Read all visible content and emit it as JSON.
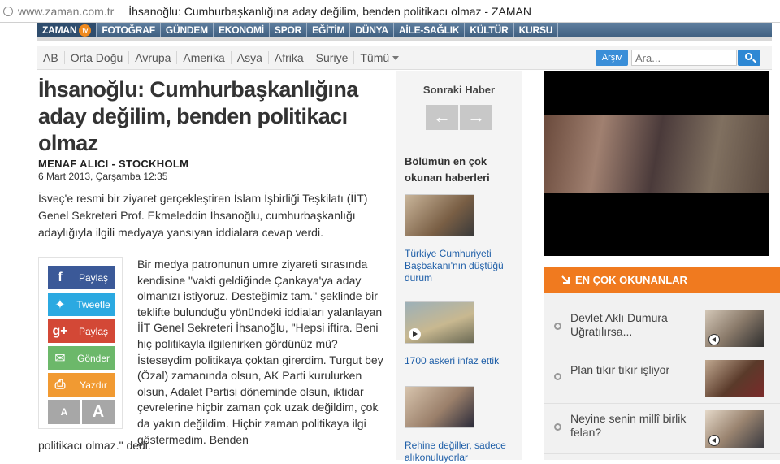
{
  "browser": {
    "url": "www.zaman.com.tr",
    "title": "İhsanoğlu: Cumhurbaşkanlığına aday değilim, benden politikacı olmaz - ZAMAN"
  },
  "main_nav": {
    "logo": "ZAMAN",
    "logo_badge": "tv",
    "items": [
      "FOTOĞRAF",
      "GÜNDEM",
      "EKONOMİ",
      "SPOR",
      "EĞİTİM",
      "DÜNYA",
      "AİLE-SAĞLIK",
      "KÜLTÜR",
      "KURSU"
    ]
  },
  "sub_nav": {
    "items": [
      "AB",
      "Orta Doğu",
      "Avrupa",
      "Amerika",
      "Asya",
      "Afrika",
      "Suriye",
      "Tümü"
    ],
    "archive_button": "Arşiv",
    "search_placeholder": "Ara..."
  },
  "article": {
    "headline": "İhsanoğlu: Cumhurbaşkanlığına aday değilim, benden politikacı olmaz",
    "author": "MENAF ALICI - STOCKHOLM",
    "date": "6 Mart 2013, Çarşamba  12:35",
    "lead": "İsveç'e resmi bir ziyaret gerçekleştiren İslam İşbirliği Teşkilatı (İİT) Genel Sekreteri Prof. Ekmeleddin İhsanoğlu, cumhurbaşkanlığı adaylığıyla ilgili medyaya yansıyan iddialara cevap verdi.",
    "body_part1": "Bir medya patronunun umre ziyareti sırasında kendisine \"vakti geldiğinde Çankaya'ya aday olmanızı istiyoruz. Desteğimiz tam.\" şeklinde bir teklifte bulunduğu yönündeki iddiaları yalanlayan İİT Genel Sekreteri İhsanoğlu, \"Hepsi iftira. Beni hiç politikayla ilgilenirken gördünüz mü? İsteseydim politikaya çoktan girerdim. Turgut bey (Özal) zamanında olsun, AK Parti kurulurken olsun, Adalet Partisi döneminde olsun, iktidar çevrelerine hiçbir zaman çok uzak değildim, çok da yakın değildim. Hiçbir zaman politikaya ilgi göstermedim. Benden",
    "body_part2": "politikacı olmaz.\" dedi."
  },
  "share": {
    "facebook": "Paylaş",
    "twitter": "Tweetle",
    "googleplus": "Paylaş",
    "email": "Gönder",
    "print": "Yazdır",
    "font_small": "A",
    "font_large": "A",
    "icons": [
      "facebook-icon",
      "twitter-icon",
      "googleplus-icon",
      "email-icon",
      "print-icon"
    ]
  },
  "middle": {
    "next_news": "Sonraki Haber",
    "most_read_title": "Bölümün en çok okunan haberleri",
    "items": [
      "Türkiye Cumhuriyeti Başbakanı'nın düştüğü durum",
      "1700 askeri infaz ettik",
      "Rehine değiller, sadece alıkonuluyorlar"
    ]
  },
  "right": {
    "most_read_header": "EN ÇOK OKUNANLAR",
    "items": [
      "Devlet Aklı Dumura Uğratılırsa...",
      "Plan tıkır tıkır işliyor",
      "Neyine senin millî birlik felan?"
    ]
  },
  "colors": {
    "nav_blue": "#4a6a8b",
    "accent_orange": "#f07a1f",
    "link_blue": "#1f5fa8",
    "search_blue": "#2e88d4"
  }
}
